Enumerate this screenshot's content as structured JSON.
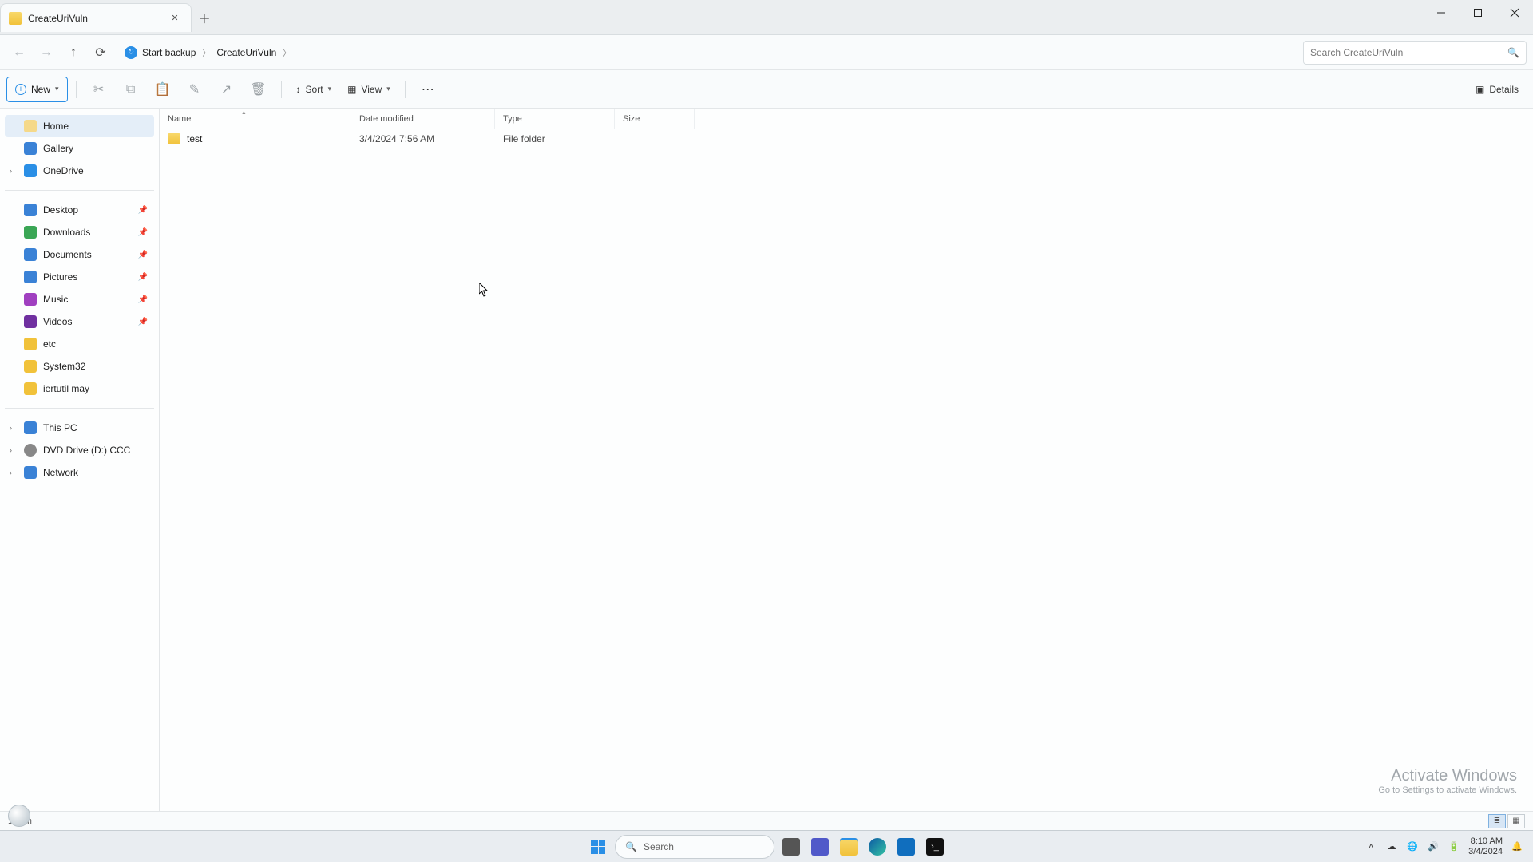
{
  "tab_title": "CreateUriVuln",
  "breadcrumbs": [
    "Start backup",
    "CreateUriVuln"
  ],
  "search_placeholder": "Search CreateUriVuln",
  "cmd": {
    "new": "New",
    "sort": "Sort",
    "view": "View",
    "details": "Details"
  },
  "columns": {
    "name": "Name",
    "date": "Date modified",
    "type": "Type",
    "size": "Size"
  },
  "rows": [
    {
      "name": "test",
      "date": "3/4/2024 7:56 AM",
      "type": "File folder",
      "size": ""
    }
  ],
  "status_text": "1 item",
  "sidebar": {
    "top": [
      {
        "label": "Home",
        "cls": "ic-home",
        "active": true
      },
      {
        "label": "Gallery",
        "cls": "ic-gallery"
      },
      {
        "label": "OneDrive",
        "cls": "ic-cloud",
        "chevron": true
      }
    ],
    "quick": [
      {
        "label": "Desktop",
        "cls": "ic-desktop",
        "pin": true
      },
      {
        "label": "Downloads",
        "cls": "ic-down",
        "pin": true
      },
      {
        "label": "Documents",
        "cls": "ic-doc",
        "pin": true
      },
      {
        "label": "Pictures",
        "cls": "ic-pic",
        "pin": true
      },
      {
        "label": "Music",
        "cls": "ic-music",
        "pin": true
      },
      {
        "label": "Videos",
        "cls": "ic-vid",
        "pin": true
      },
      {
        "label": "etc",
        "cls": "ic-folder"
      },
      {
        "label": "System32",
        "cls": "ic-folder"
      },
      {
        "label": "iertutil may",
        "cls": "ic-folder"
      }
    ],
    "bottom": [
      {
        "label": "This PC",
        "cls": "ic-pc",
        "chevron": true
      },
      {
        "label": "DVD Drive (D:) CCC",
        "cls": "ic-dvd",
        "chevron": true
      },
      {
        "label": "Network",
        "cls": "ic-net",
        "chevron": true
      }
    ]
  },
  "watermark": {
    "l1": "Activate Windows",
    "l2": "Go to Settings to activate Windows."
  },
  "taskbar_search": "Search",
  "tray_time": "8:10 AM",
  "tray_date": "3/4/2024"
}
